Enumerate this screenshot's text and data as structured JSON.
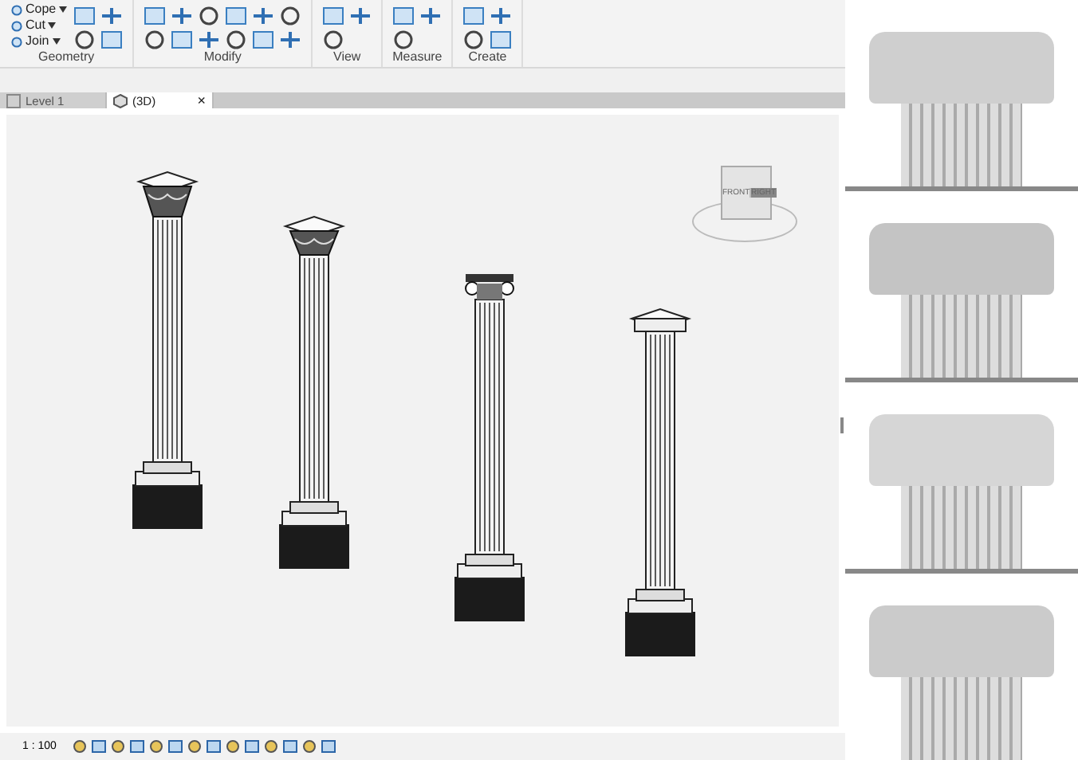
{
  "ribbon": {
    "groups": [
      {
        "label": "Geometry",
        "tools": [
          "Cope",
          "Cut",
          "Join"
        ]
      },
      {
        "label": "Modify"
      },
      {
        "label": "View"
      },
      {
        "label": "Measure"
      },
      {
        "label": "Create"
      }
    ]
  },
  "view_tabs": [
    {
      "label": "Level 1",
      "selected": false
    },
    {
      "label": "(3D)",
      "selected": true,
      "close": "×"
    }
  ],
  "viewcube": {
    "faces": [
      "FRONT",
      "RIGHT"
    ]
  },
  "columns": [
    {
      "kind": "corinthian"
    },
    {
      "kind": "composite"
    },
    {
      "kind": "ionic"
    },
    {
      "kind": "doric"
    }
  ],
  "renders": [
    {
      "kind": "corinthian"
    },
    {
      "kind": "composite"
    },
    {
      "kind": "ionic"
    },
    {
      "kind": "doric"
    }
  ],
  "status_bar": {
    "scale": "1 : 100"
  }
}
